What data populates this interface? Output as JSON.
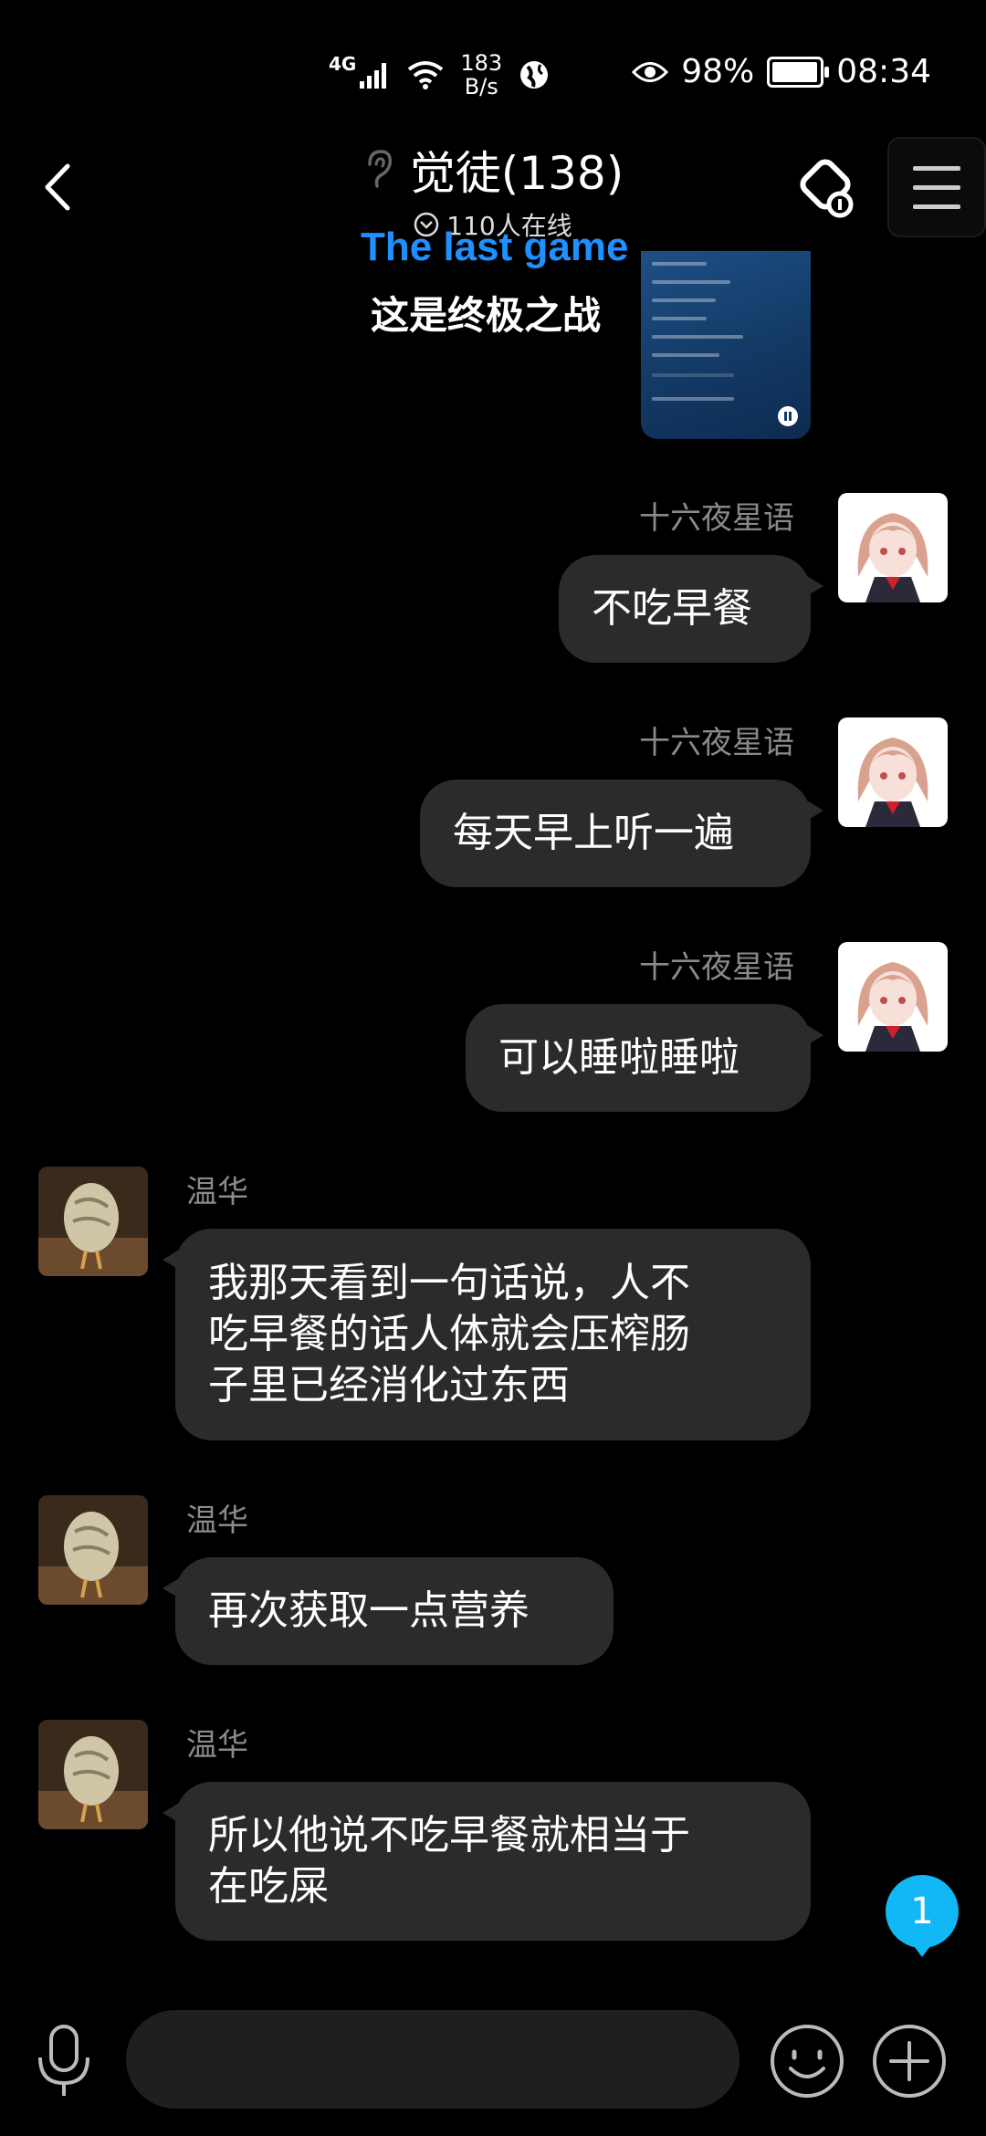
{
  "status_bar": {
    "network": "4G",
    "speed_value": "183",
    "speed_unit": "B/s",
    "battery_percent": "98%",
    "battery_level": 0.98,
    "time": "08:34"
  },
  "header": {
    "title": "觉徒(138)",
    "online_text": "110人在线"
  },
  "song": {
    "title": "The last game",
    "subtitle": "这是终极之战"
  },
  "messages": [
    {
      "sender": "十六夜星语",
      "side": "right",
      "lines": [
        "不吃早餐"
      ]
    },
    {
      "sender": "十六夜星语",
      "side": "right",
      "lines": [
        "每天早上听一遍"
      ]
    },
    {
      "sender": "十六夜星语",
      "side": "right",
      "lines": [
        "可以睡啦睡啦"
      ]
    },
    {
      "sender": "温华",
      "side": "left",
      "lines": [
        "我那天看到一句话说，人不",
        "吃早餐的话人体就会压榨肠",
        "子里已经消化过东西"
      ]
    },
    {
      "sender": "温华",
      "side": "left",
      "lines": [
        "再次获取一点营养"
      ]
    },
    {
      "sender": "温华",
      "side": "left",
      "lines": [
        "所以他说不吃早餐就相当于",
        "在吃屎"
      ]
    }
  ],
  "unread_badge": "1",
  "input": {
    "value": "",
    "placeholder": ""
  },
  "colors": {
    "background": "#000000",
    "bubble": "#2b2b2b",
    "accent": "#1e90ff",
    "badge": "#12b7f5"
  }
}
